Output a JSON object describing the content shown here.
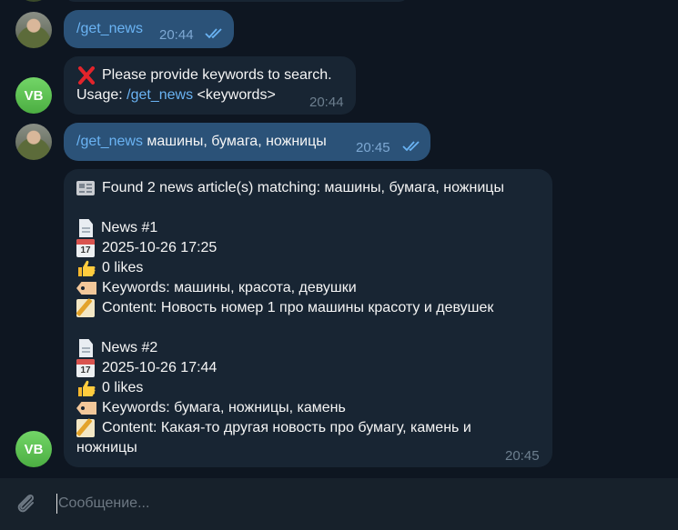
{
  "messages": [
    {
      "text_link": "/get_news",
      "time": "20:44",
      "read": true
    },
    {
      "line1": "Please provide keywords to search.",
      "line2_prefix": "Usage: ",
      "line2_link": "/get_news",
      "line2_suffix": " <keywords>",
      "time": "20:44",
      "icon": "cross-mark-icon"
    },
    {
      "text_link": "/get_news",
      "text_rest": " машины, бумага, ножницы",
      "time": "20:45",
      "read": true
    },
    {
      "header": "Found 2 news article(s) matching: машины, бумага, ножницы",
      "news": [
        {
          "title": "News #1",
          "date": "2025-10-26 17:25",
          "likes": "0 likes",
          "keywords": "Keywords: машины, красота, девушки",
          "content": "Content: Новость номер 1 про машины красоту и девушек"
        },
        {
          "title": "News #2",
          "date": "2025-10-26 17:44",
          "likes": "0 likes",
          "keywords": "Keywords: бумага, ножницы, камень",
          "content_line1": "Content: Какая-то другая новость про бумагу, камень и",
          "content_line2": "ножницы"
        }
      ],
      "time": "20:45"
    }
  ],
  "avatars": {
    "bot_initials": "VB"
  },
  "composer": {
    "placeholder": "Сообщение..."
  },
  "colors": {
    "outgoing_bubble": "#2b5278",
    "incoming_bubble": "#182533",
    "link": "#6ab3f3",
    "background": "#0e1621"
  }
}
